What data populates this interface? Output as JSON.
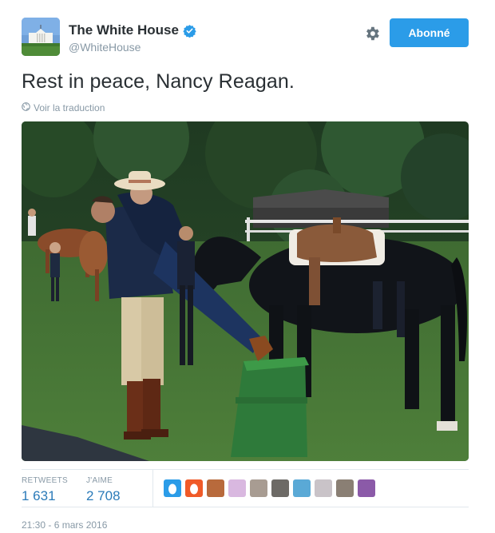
{
  "account": {
    "display_name": "The White House",
    "handle": "@WhiteHouse",
    "verified": true
  },
  "actions": {
    "follow_label": "Abonné"
  },
  "tweet": {
    "text": "Rest in peace, Nancy Reagan.",
    "translate_label": "Voir la traduction",
    "timestamp": "21:30 - 6 mars 2016"
  },
  "stats": {
    "retweets_label": "RETWEETS",
    "retweets_value": "1 631",
    "likes_label": "J'AIME",
    "likes_value": "2 708"
  },
  "likers": [
    {
      "name": "egg-avatar-blue",
      "color": "#2b9ce8"
    },
    {
      "name": "egg-avatar-orange",
      "color": "#f05a28"
    },
    {
      "name": "avatar-woman",
      "color": "#b86a3c"
    },
    {
      "name": "avatar-text-badge",
      "color": "#d9b8e0"
    },
    {
      "name": "avatar-man-grey",
      "color": "#a89c92"
    },
    {
      "name": "avatar-man-glasses",
      "color": "#6d6a66"
    },
    {
      "name": "avatar-beach",
      "color": "#5aa9d6"
    },
    {
      "name": "avatar-sketch",
      "color": "#c9c3c8"
    },
    {
      "name": "avatar-cat",
      "color": "#8a7f74"
    },
    {
      "name": "avatar-purple",
      "color": "#8b5aa8"
    }
  ],
  "colors": {
    "accent": "#2b9ce8",
    "link": "#2b7bb9",
    "muted": "#8899a6"
  }
}
